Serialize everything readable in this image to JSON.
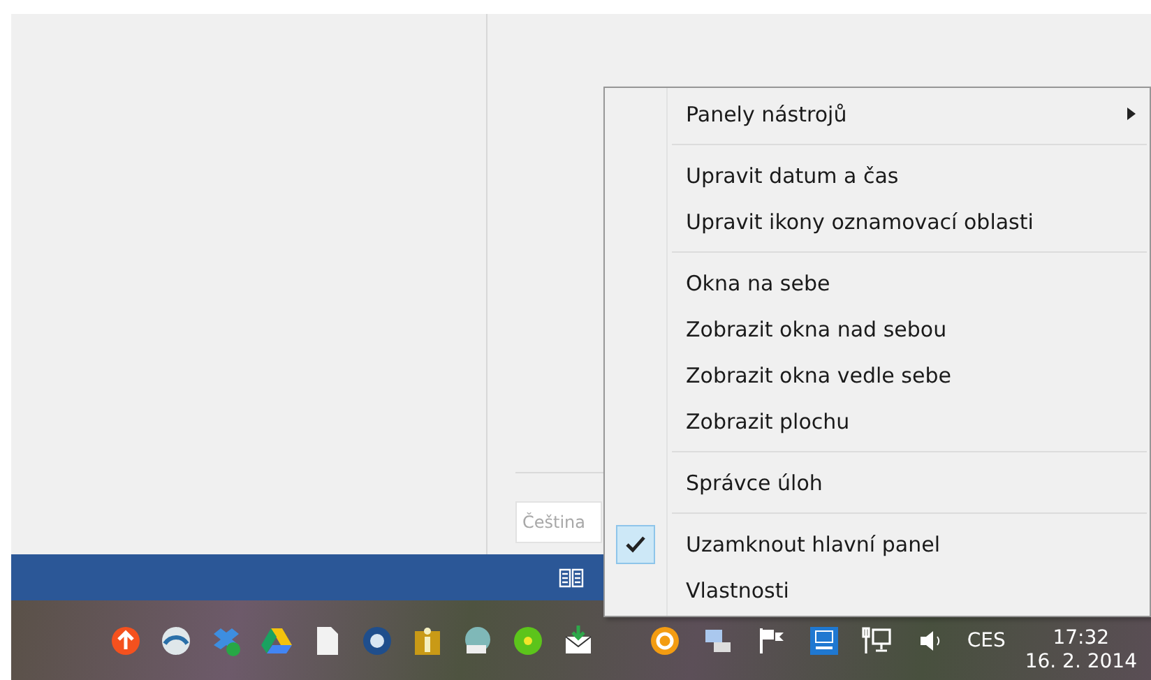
{
  "settings_panel": {
    "language_field": {
      "placeholder": "Čeština"
    }
  },
  "taskbar": {
    "tray": {
      "language": "CES",
      "time": "17:32",
      "date": "16. 2. 2014"
    }
  },
  "context_menu": {
    "groups": [
      [
        {
          "label": "Panely nástrojů",
          "has_submenu": true,
          "checked": false
        }
      ],
      [
        {
          "label": "Upravit datum a čas",
          "has_submenu": false,
          "checked": false
        },
        {
          "label": "Upravit ikony oznamovací oblasti",
          "has_submenu": false,
          "checked": false
        }
      ],
      [
        {
          "label": "Okna na sebe",
          "has_submenu": false,
          "checked": false
        },
        {
          "label": "Zobrazit okna nad sebou",
          "has_submenu": false,
          "checked": false
        },
        {
          "label": "Zobrazit okna vedle sebe",
          "has_submenu": false,
          "checked": false
        },
        {
          "label": "Zobrazit plochu",
          "has_submenu": false,
          "checked": false
        }
      ],
      [
        {
          "label": "Správce úloh",
          "has_submenu": false,
          "checked": false
        }
      ],
      [
        {
          "label": "Uzamknout hlavní panel",
          "has_submenu": false,
          "checked": true
        },
        {
          "label": "Vlastnosti",
          "has_submenu": false,
          "checked": false
        }
      ]
    ]
  }
}
